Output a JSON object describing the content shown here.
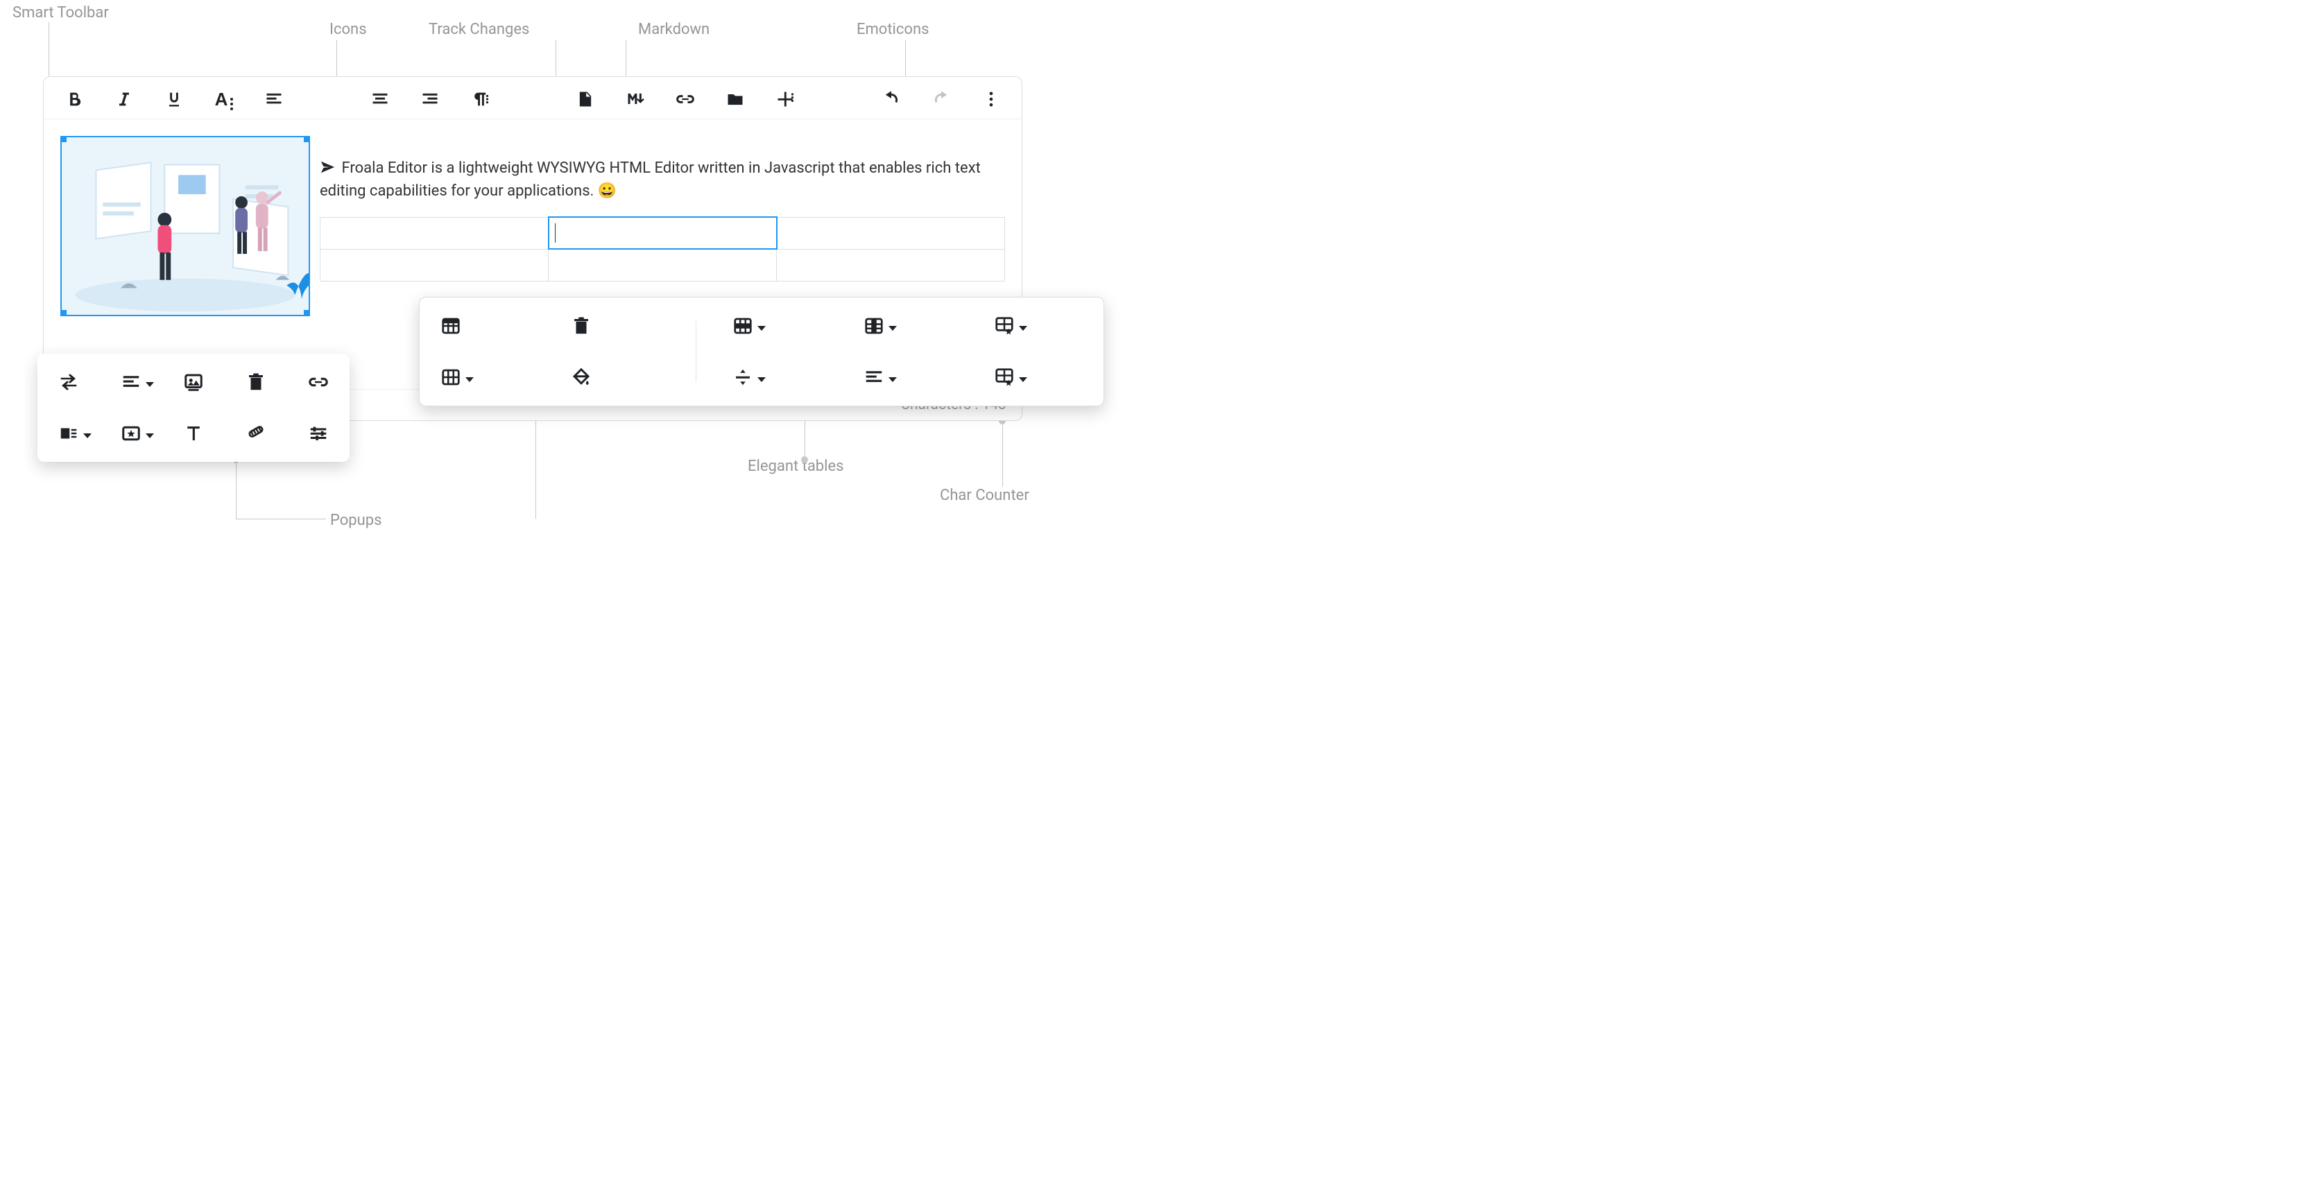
{
  "labels": {
    "smart_toolbar": "Smart Toolbar",
    "icons": "Icons",
    "track_changes": "Track Changes",
    "markdown": "Markdown",
    "emoticons": "Emoticons",
    "popups": "Popups",
    "elegant_tables": "Elegant tables",
    "char_counter": "Char Counter"
  },
  "toolbar": {
    "buttons": [
      "bold",
      "italic",
      "underline",
      "format-more",
      "align-left",
      "align-center",
      "align-right",
      "paragraph-more",
      "track-changes",
      "markdown",
      "insert-link",
      "insert-file",
      "insert-more",
      "undo",
      "redo",
      "more-vertical"
    ]
  },
  "content": {
    "paragraph_text": "Froala Editor is a lightweight WYSIWYG HTML Editor written in Javascript that enables rich text editing capabilities for your applications.",
    "emoji": "😀",
    "table": {
      "rows": 2,
      "cols": 3,
      "active_cell": [
        0,
        1
      ]
    }
  },
  "footer": {
    "char_label": "Characters",
    "char_count": "143"
  },
  "image_popup": {
    "buttons": [
      "replace",
      "align",
      "caption",
      "remove",
      "link",
      "display",
      "style",
      "alt-text",
      "size",
      "advanced"
    ]
  },
  "table_popup": {
    "buttons_left": [
      "table-header",
      "remove-table"
    ],
    "buttons_right_row1": [
      "row",
      "column",
      "cell-style"
    ],
    "buttons_right_row2": [
      "cells",
      "cell-bg",
      "vertical-align",
      "horizontal-align",
      "table-style"
    ]
  }
}
